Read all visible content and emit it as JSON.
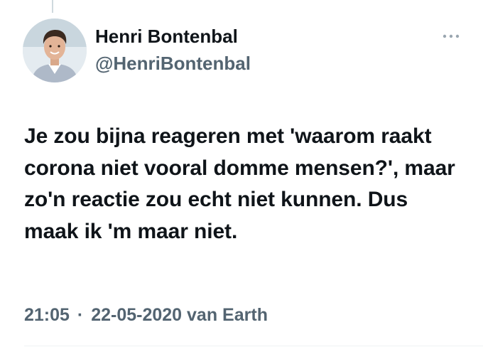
{
  "author": {
    "display_name": "Henri Bontenbal",
    "handle": "@HenriBontenbal"
  },
  "tweet": {
    "text": "Je zou bijna reageren met 'waarom raakt corona niet vooral domme mensen?', maar zo'n reactie zou echt niet kunnen. Dus maak ik 'm maar niet."
  },
  "meta": {
    "time": "21:05",
    "separator": "·",
    "date": "22-05-2020",
    "source": "van Earth"
  },
  "icons": {
    "more": "more-horizontal-icon",
    "avatar": "profile-photo"
  },
  "colors": {
    "text": "#0f1419",
    "secondary": "#536471",
    "divider": "#eff3f4"
  }
}
